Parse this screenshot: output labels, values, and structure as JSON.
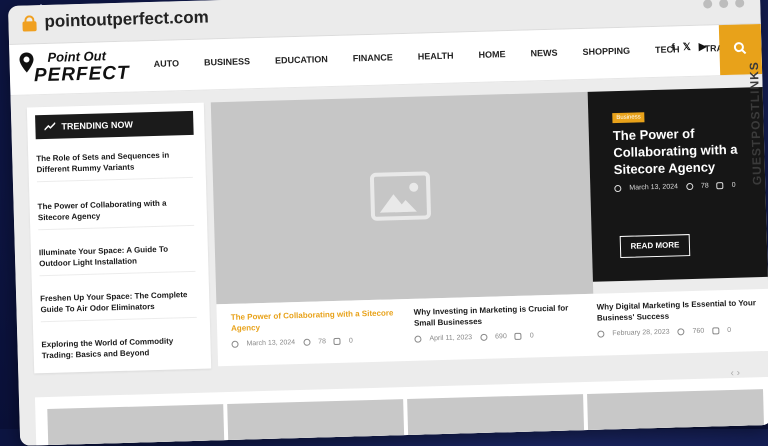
{
  "browser": {
    "url": "pointoutperfect.com"
  },
  "logo": {
    "line1": "Point Out",
    "line2": "PERFECT"
  },
  "nav": [
    "AUTO",
    "BUSINESS",
    "EDUCATION",
    "FINANCE",
    "HEALTH",
    "HOME",
    "NEWS",
    "SHOPPING",
    "TECH",
    "TRAVEL"
  ],
  "social": [
    "f",
    "𝕏",
    "▶"
  ],
  "icons": {
    "lock": "lock-icon",
    "search": "search-icon",
    "trend": "trending-icon",
    "clock": "clock-icon",
    "eye": "eye-icon",
    "comment": "comment-icon",
    "image": "image-placeholder-icon"
  },
  "colors": {
    "accent": "#e8a21a",
    "dark": "#161616",
    "page": "#ececec"
  },
  "trending": {
    "heading": "TRENDING NOW",
    "items": [
      "The Role of Sets and Sequences in Different Rummy Variants",
      "The Power of Collaborating with a Sitecore Agency",
      "Illuminate Your Space: A Guide To Outdoor Light Installation",
      "Freshen Up Your Space: The Complete Guide To Air Odor Eliminators",
      "Exploring the World of Commodity Trading: Basics and Beyond"
    ]
  },
  "feature": {
    "badge": "Business",
    "title": "The Power of Collaborating with a Sitecore Agency",
    "date": "March 13, 2024",
    "views": "78",
    "comments": "0",
    "read_more": "READ MORE"
  },
  "watermark": {
    "text": "GUESTPOSTLINKS"
  },
  "cards": [
    {
      "title": "The Power of Collaborating with a Sitecore Agency",
      "date": "March 13, 2024",
      "views": "78",
      "comments": "0"
    },
    {
      "title": "Why Investing in Marketing is Crucial for Small Businesses",
      "date": "April 11, 2023",
      "views": "690",
      "comments": "0"
    },
    {
      "title": "Why Digital Marketing Is Essential to Your Business' Success",
      "date": "February 28, 2023",
      "views": "760",
      "comments": "0"
    }
  ],
  "carousel": {
    "prev": "‹",
    "next": "›"
  }
}
